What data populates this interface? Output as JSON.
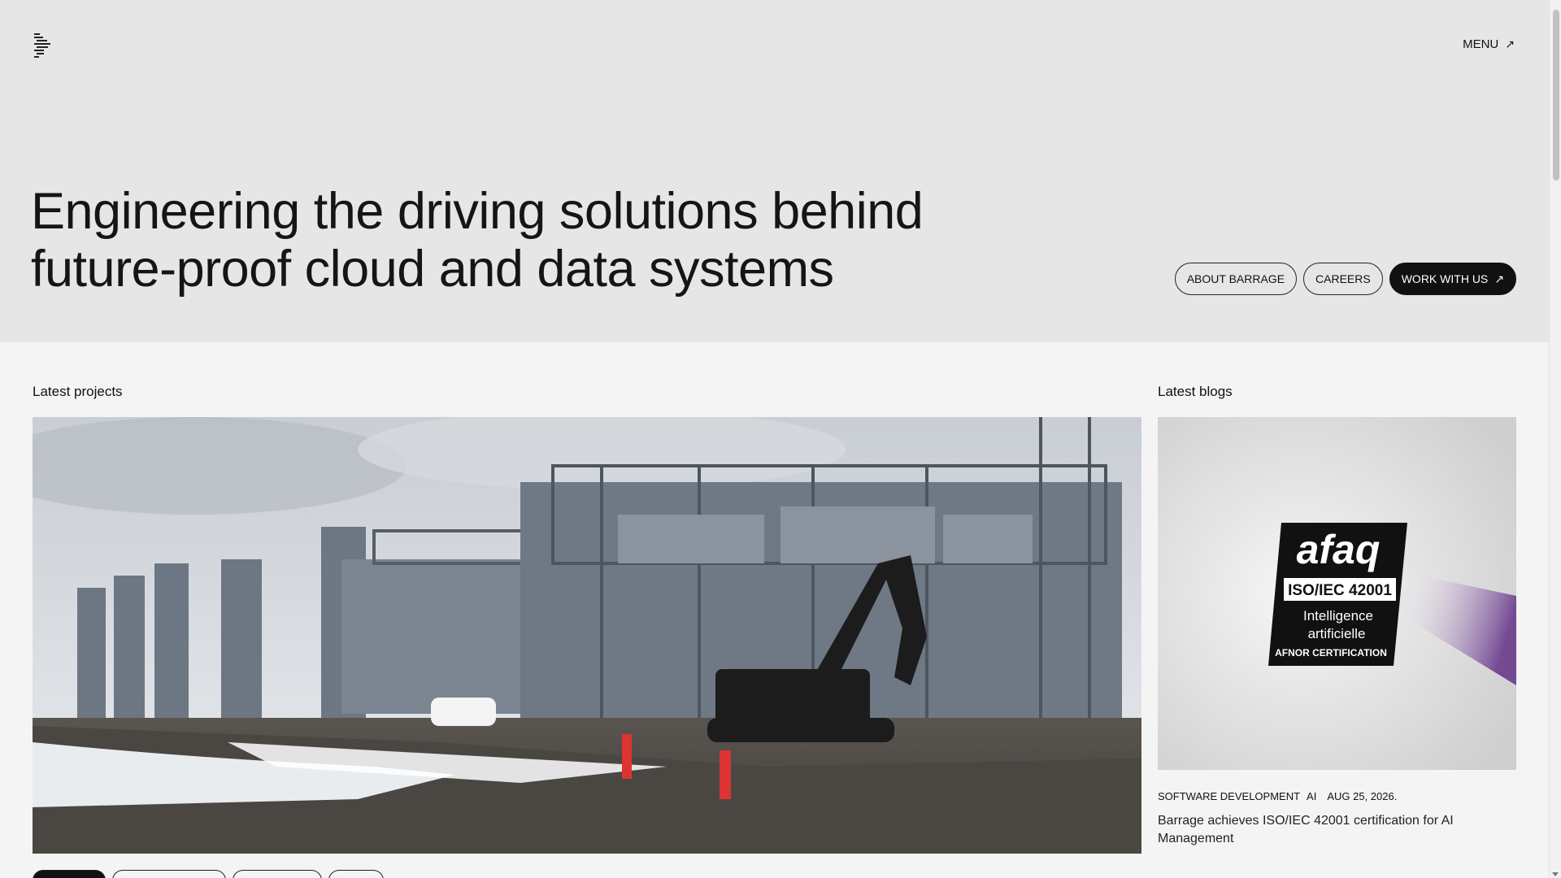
{
  "header": {
    "menu_label": "MENU",
    "menu_icon": "arrow-up-right-icon"
  },
  "hero": {
    "headline_line1": "Engineering the driving solutions behind",
    "headline_line2": "future-proof cloud and data systems",
    "buttons": {
      "about": "ABOUT BARRAGE",
      "careers": "CAREERS",
      "work": "WORK WITH US"
    }
  },
  "projects": {
    "label": "Latest projects",
    "tags": [
      "",
      "",
      "",
      ""
    ]
  },
  "blogs": {
    "label": "Latest blogs",
    "logo_text": {
      "brand": "afaq",
      "standard": "ISO/IEC 42001",
      "line1": "Intelligence",
      "line2": "artificielle",
      "cert": "AFNOR CERTIFICATION"
    },
    "category1": "SOFTWARE DEVELOPMENT",
    "category2": "AI",
    "date": "AUG 25, 2026.",
    "title": "Barrage achieves ISO/IEC 42001 certification for AI Management"
  },
  "colors": {
    "hero_bg": "#e6e6e6",
    "page_bg": "#f4f4f4",
    "dark": "#111111",
    "afaq_purple": "#6a3a8c"
  }
}
